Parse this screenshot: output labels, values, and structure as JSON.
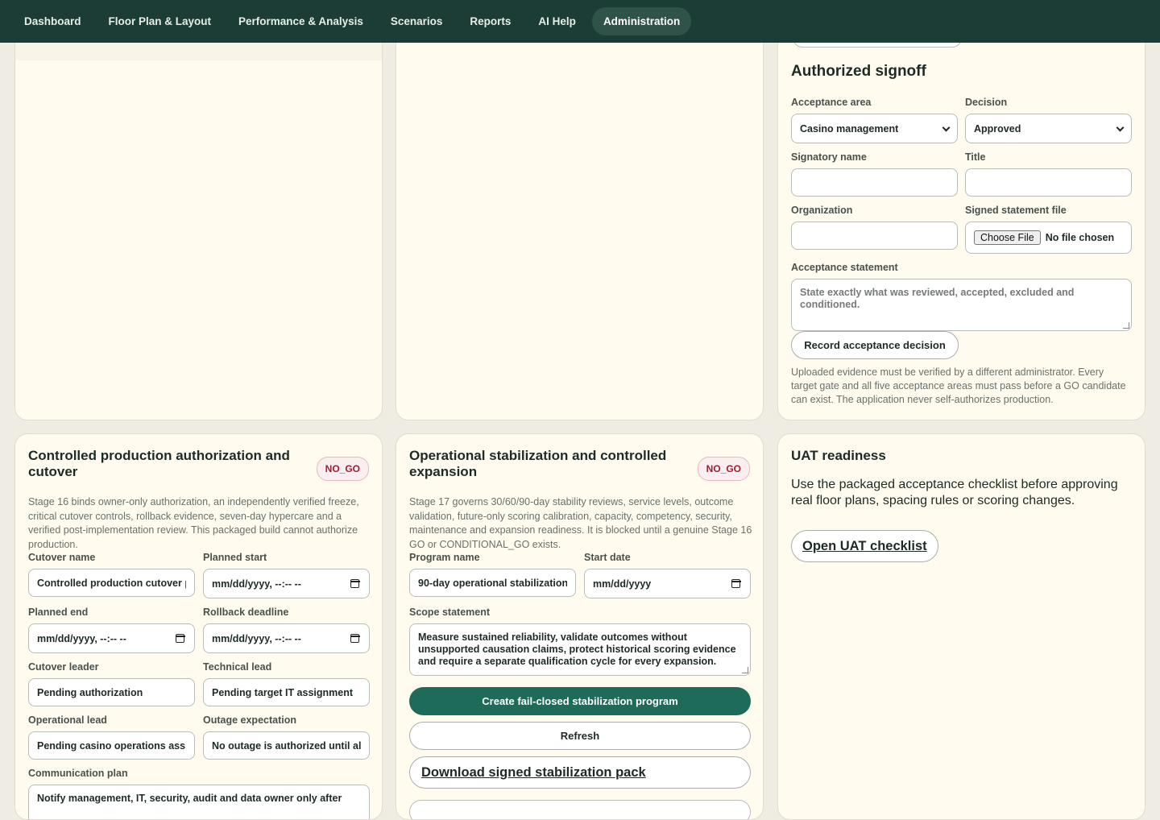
{
  "nav": {
    "items": [
      {
        "label": "Dashboard"
      },
      {
        "label": "Floor Plan & Layout"
      },
      {
        "label": "Performance & Analysis"
      },
      {
        "label": "Scenarios"
      },
      {
        "label": "Reports"
      },
      {
        "label": "AI Help"
      },
      {
        "label": "Administration"
      }
    ],
    "active": "Administration"
  },
  "signoff": {
    "title": "Authorized signoff",
    "acceptance_area_label": "Acceptance area",
    "acceptance_area_value": "Casino management",
    "decision_label": "Decision",
    "decision_value": "Approved",
    "signatory_label": "Signatory name",
    "signatory_value": "",
    "title_label": "Title",
    "title_value": "",
    "organization_label": "Organization",
    "organization_value": "",
    "file_label": "Signed statement file",
    "file_button": "Choose File",
    "file_status": "No file chosen",
    "statement_label": "Acceptance statement",
    "statement_placeholder": "State exactly what was reviewed, accepted, excluded and conditioned.",
    "record_button": "Record acceptance decision",
    "note": "Uploaded evidence must be verified by a different administrator. Every target gate and all five acceptance areas must pass before a GO candidate can exist. The application never self-authorizes production."
  },
  "cutover": {
    "title": "Controlled production authorization and cutover",
    "status": "NO_GO",
    "description": "Stage 16 binds owner-only authorization, an independently verified freeze, critical cutover controls, rollback evidence, seven-day hypercare and a verified post-implementation review. This packaged build cannot authorize production.",
    "name_label": "Cutover name",
    "name_value": "Controlled production cutover p",
    "start_label": "Planned start",
    "start_value": "mm/dd/yyyy, --:-- --",
    "end_label": "Planned end",
    "end_value": "mm/dd/yyyy, --:-- --",
    "rollback_label": "Rollback deadline",
    "rollback_value": "mm/dd/yyyy, --:-- --",
    "leader_label": "Cutover leader",
    "leader_value": "Pending authorization",
    "tech_label": "Technical lead",
    "tech_value": "Pending target IT assignment",
    "ops_label": "Operational lead",
    "ops_value": "Pending casino operations assig",
    "outage_label": "Outage expectation",
    "outage_value": "No outage is authorized until all",
    "comm_label": "Communication plan",
    "comm_value": "Notify management, IT, security, audit and data owner only after"
  },
  "stabilization": {
    "title": "Operational stabilization and controlled expansion",
    "status": "NO_GO",
    "description": "Stage 17 governs 30/60/90-day stability reviews, service levels, outcome validation, future-only scoring calibration, capacity, competency, security, maintenance and expansion readiness. It is blocked until a genuine Stage 16 GO or CONDITIONAL_GO exists.",
    "program_label": "Program name",
    "program_value": "90-day operational stabilization",
    "start_label": "Start date",
    "start_value": "mm/dd/yyyy",
    "scope_label": "Scope statement",
    "scope_value": "Measure sustained reliability, validate outcomes without unsupported causation claims, protect historical scoring evidence and require a separate qualification cycle for every expansion.",
    "create_button": "Create fail-closed stabilization program",
    "refresh_button": "Refresh",
    "download_link": "Download signed stabilization pack"
  },
  "uat": {
    "title": "UAT readiness",
    "text": "Use the packaged acceptance checklist before approving real floor plans, spacing rules or scoring changes.",
    "link": "Open UAT checklist"
  },
  "colors": {
    "nav_bg": "#1b3d35",
    "card_bg": "#fffbef",
    "primary": "#1f6b5a",
    "no_go": "#9b1f2e"
  }
}
